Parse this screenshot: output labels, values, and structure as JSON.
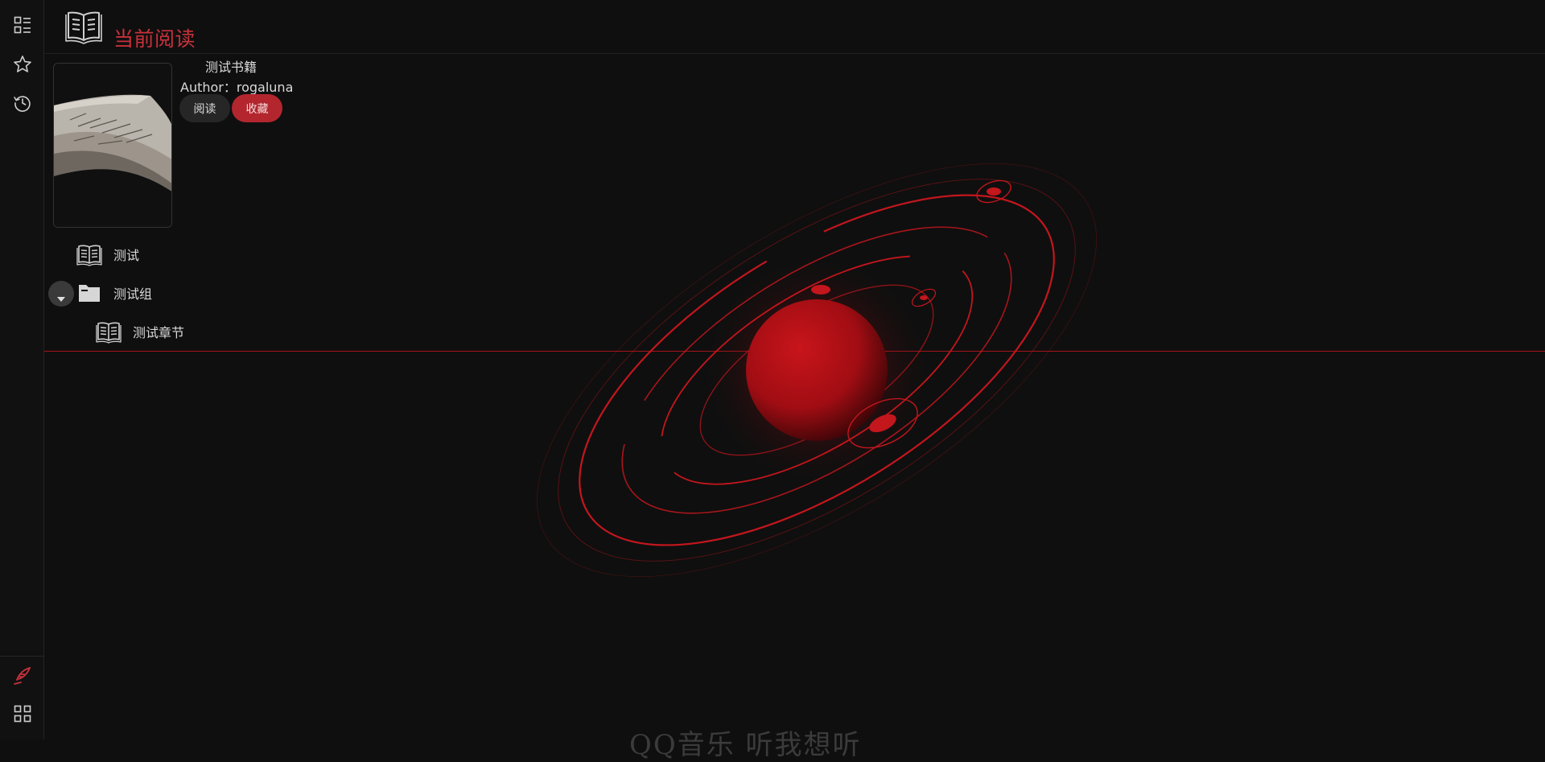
{
  "sidebar": {
    "top_icons": [
      "catalog-icon",
      "star-icon",
      "history-icon"
    ],
    "bottom_icons": [
      "quill-icon",
      "apps-icon"
    ]
  },
  "header": {
    "title": "当前阅读",
    "icon": "open-book-icon"
  },
  "book": {
    "title": "测试书籍",
    "author": "Author：rogaluna",
    "read_label": "阅读",
    "favorite_label": "收藏"
  },
  "tree": [
    {
      "label": "测试",
      "icon": "book-icon"
    },
    {
      "label": "测试组",
      "icon": "folder-icon",
      "expanded": true
    },
    {
      "label": "测试章节",
      "icon": "book-icon"
    }
  ],
  "footer": {
    "text": "QQ音乐 听我想听"
  },
  "colors": {
    "accent": "#c8313b",
    "background": "#0f0f0f",
    "sidebar": "#111111",
    "button_dark": "#262626",
    "button_red": "#b3262e"
  }
}
